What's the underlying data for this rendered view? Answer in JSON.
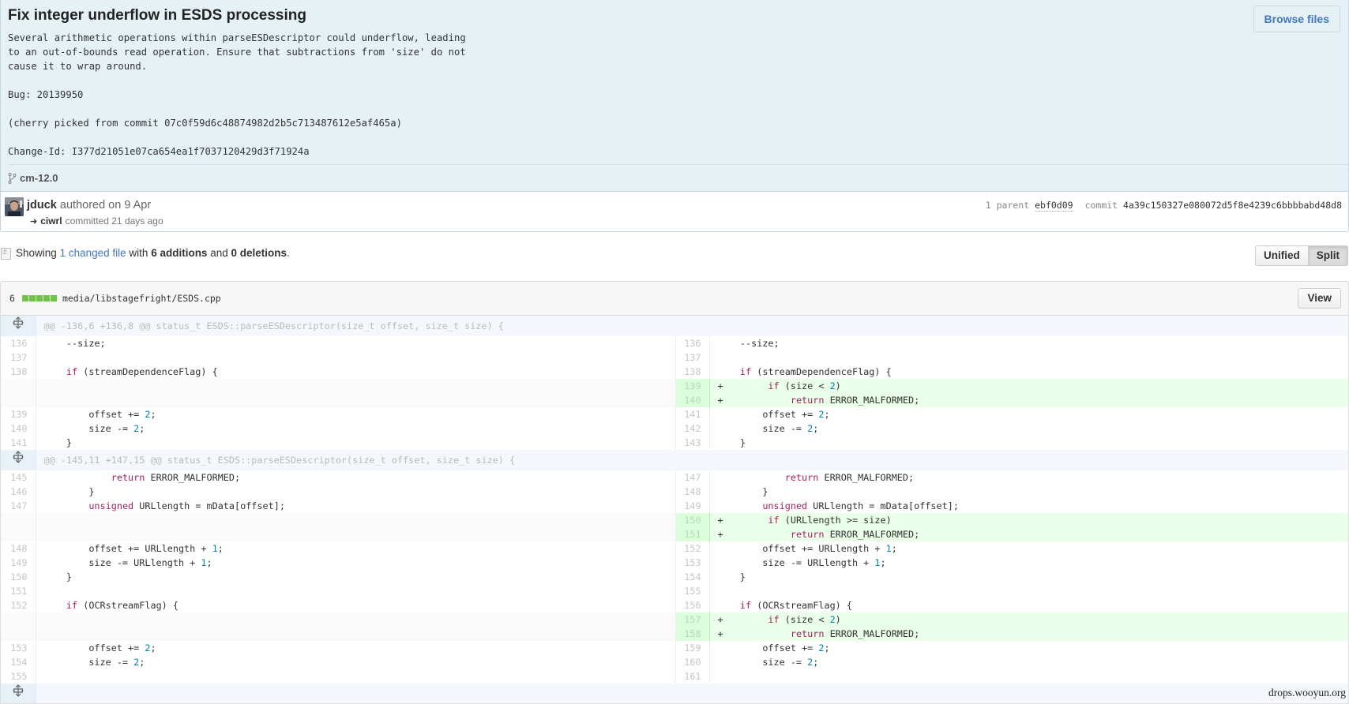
{
  "commit": {
    "title": "Fix integer underflow in ESDS processing",
    "description_lines": [
      "Several arithmetic operations within parseESDescriptor could underflow, leading",
      "to an out-of-bounds read operation. Ensure that subtractions from 'size' do not",
      "cause it to wrap around.",
      "",
      "Bug: 20139950",
      "",
      "(cherry picked from commit 07c0f59d6c48874982d2b5c713487612e5af465a)",
      "",
      "Change-Id: I377d21051e07ca654ea1f7037120429d3f71924a"
    ],
    "browse_files_label": "Browse files",
    "branch": "cm-12.0",
    "author": "jduck",
    "authored_text": "authored on 9 Apr",
    "committer": "ciwrl",
    "committed_text": "committed 21 days ago",
    "parent_label": "1 parent",
    "parent_sha": "ebf0d09",
    "commit_label": "commit",
    "commit_sha": "4a39c150327e080072d5f8e4239c6bbbbabd48d8"
  },
  "toc": {
    "showing": "Showing",
    "changed_files": "1 changed file",
    "with": "with",
    "additions": "6 additions",
    "and": "and",
    "deletions": "0 deletions",
    "period": ".",
    "unified_label": "Unified",
    "split_label": "Split",
    "active_view": "Split"
  },
  "file": {
    "change_count": "6",
    "path": "media/libstagefright/ESDS.cpp",
    "view_label": "View",
    "diffstat_color": "#6cc644"
  },
  "diff": {
    "hunks": [
      {
        "header": "@@ -136,6 +136,8 @@ status_t ESDS::parseESDescriptor(size_t offset, size_t size) {",
        "rows": [
          {
            "ln": "136",
            "lc": "    --size;",
            "rn": "136",
            "rc": "    --size;",
            "type": "ctx"
          },
          {
            "ln": "137",
            "lc": "",
            "rn": "137",
            "rc": "",
            "type": "ctx"
          },
          {
            "ln": "138",
            "lc": "    if (streamDependenceFlag) {",
            "rn": "138",
            "rc": "    if (streamDependenceFlag) {",
            "type": "ctx"
          },
          {
            "ln": "",
            "lc": "",
            "rn": "139",
            "rc": "+        if (size < 2)",
            "type": "add"
          },
          {
            "ln": "",
            "lc": "",
            "rn": "140",
            "rc": "+            return ERROR_MALFORMED;",
            "type": "add"
          },
          {
            "ln": "139",
            "lc": "        offset += 2;",
            "rn": "141",
            "rc": "        offset += 2;",
            "type": "ctx"
          },
          {
            "ln": "140",
            "lc": "        size -= 2;",
            "rn": "142",
            "rc": "        size -= 2;",
            "type": "ctx"
          },
          {
            "ln": "141",
            "lc": "    }",
            "rn": "143",
            "rc": "    }",
            "type": "ctx"
          }
        ]
      },
      {
        "header": "@@ -145,11 +147,15 @@ status_t ESDS::parseESDescriptor(size_t offset, size_t size) {",
        "rows": [
          {
            "ln": "145",
            "lc": "            return ERROR_MALFORMED;",
            "rn": "147",
            "rc": "            return ERROR_MALFORMED;",
            "type": "ctx"
          },
          {
            "ln": "146",
            "lc": "        }",
            "rn": "148",
            "rc": "        }",
            "type": "ctx"
          },
          {
            "ln": "147",
            "lc": "        unsigned URLlength = mData[offset];",
            "rn": "149",
            "rc": "        unsigned URLlength = mData[offset];",
            "type": "ctx"
          },
          {
            "ln": "",
            "lc": "",
            "rn": "150",
            "rc": "+        if (URLlength >= size)",
            "type": "add"
          },
          {
            "ln": "",
            "lc": "",
            "rn": "151",
            "rc": "+            return ERROR_MALFORMED;",
            "type": "add"
          },
          {
            "ln": "148",
            "lc": "        offset += URLlength + 1;",
            "rn": "152",
            "rc": "        offset += URLlength + 1;",
            "type": "ctx"
          },
          {
            "ln": "149",
            "lc": "        size -= URLlength + 1;",
            "rn": "153",
            "rc": "        size -= URLlength + 1;",
            "type": "ctx"
          },
          {
            "ln": "150",
            "lc": "    }",
            "rn": "154",
            "rc": "    }",
            "type": "ctx"
          },
          {
            "ln": "151",
            "lc": "",
            "rn": "155",
            "rc": "",
            "type": "ctx"
          },
          {
            "ln": "152",
            "lc": "    if (OCRstreamFlag) {",
            "rn": "156",
            "rc": "    if (OCRstreamFlag) {",
            "type": "ctx"
          },
          {
            "ln": "",
            "lc": "",
            "rn": "157",
            "rc": "+        if (size < 2)",
            "type": "add"
          },
          {
            "ln": "",
            "lc": "",
            "rn": "158",
            "rc": "+            return ERROR_MALFORMED;",
            "type": "add"
          },
          {
            "ln": "153",
            "lc": "        offset += 2;",
            "rn": "159",
            "rc": "        offset += 2;",
            "type": "ctx"
          },
          {
            "ln": "154",
            "lc": "        size -= 2;",
            "rn": "160",
            "rc": "        size -= 2;",
            "type": "ctx"
          },
          {
            "ln": "155",
            "lc": "",
            "rn": "161",
            "rc": "",
            "type": "ctx"
          }
        ]
      }
    ]
  },
  "watermark": "drops.wooyun.org"
}
